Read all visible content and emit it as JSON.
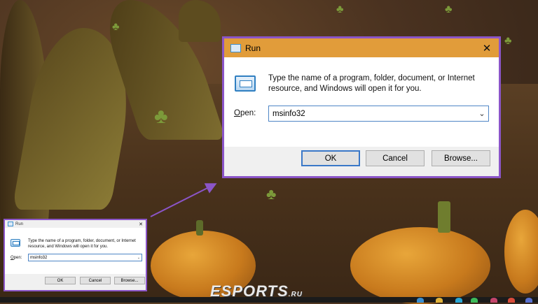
{
  "large_dialog": {
    "title": "Run",
    "close_symbol": "✕",
    "instructions": "Type the name of a program, folder, document, or Internet resource, and Windows will open it for you.",
    "open_label_prefix": "O",
    "open_label_rest": "pen:",
    "open_value": "msinfo32",
    "dropdown_symbol": "⌄",
    "ok_label": "OK",
    "cancel_label": "Cancel",
    "browse_label": "Browse..."
  },
  "small_dialog": {
    "title": "Run",
    "close_symbol": "✕",
    "instructions": "Type the name of a program, folder, document, or Internet resource, and Windows will open it for you.",
    "open_label_prefix": "O",
    "open_label_rest": "pen:",
    "open_value": "msinfo32",
    "dropdown_symbol": "⌄",
    "ok_label": "OK",
    "cancel_label": "Cancel",
    "browse_label": "Browse..."
  },
  "watermark": {
    "text": "ESPORTS",
    "suffix": ".RU"
  },
  "icons": {
    "run": "run-app-icon",
    "close": "close-icon",
    "dropdown": "chevron-down-icon",
    "arrow": "annotation-arrow"
  },
  "colors": {
    "highlight_border": "#8b55c8",
    "title_bar": "#e19c3a",
    "dialog_bg": "#f0f0f0",
    "accent_blue": "#3a78c8"
  }
}
